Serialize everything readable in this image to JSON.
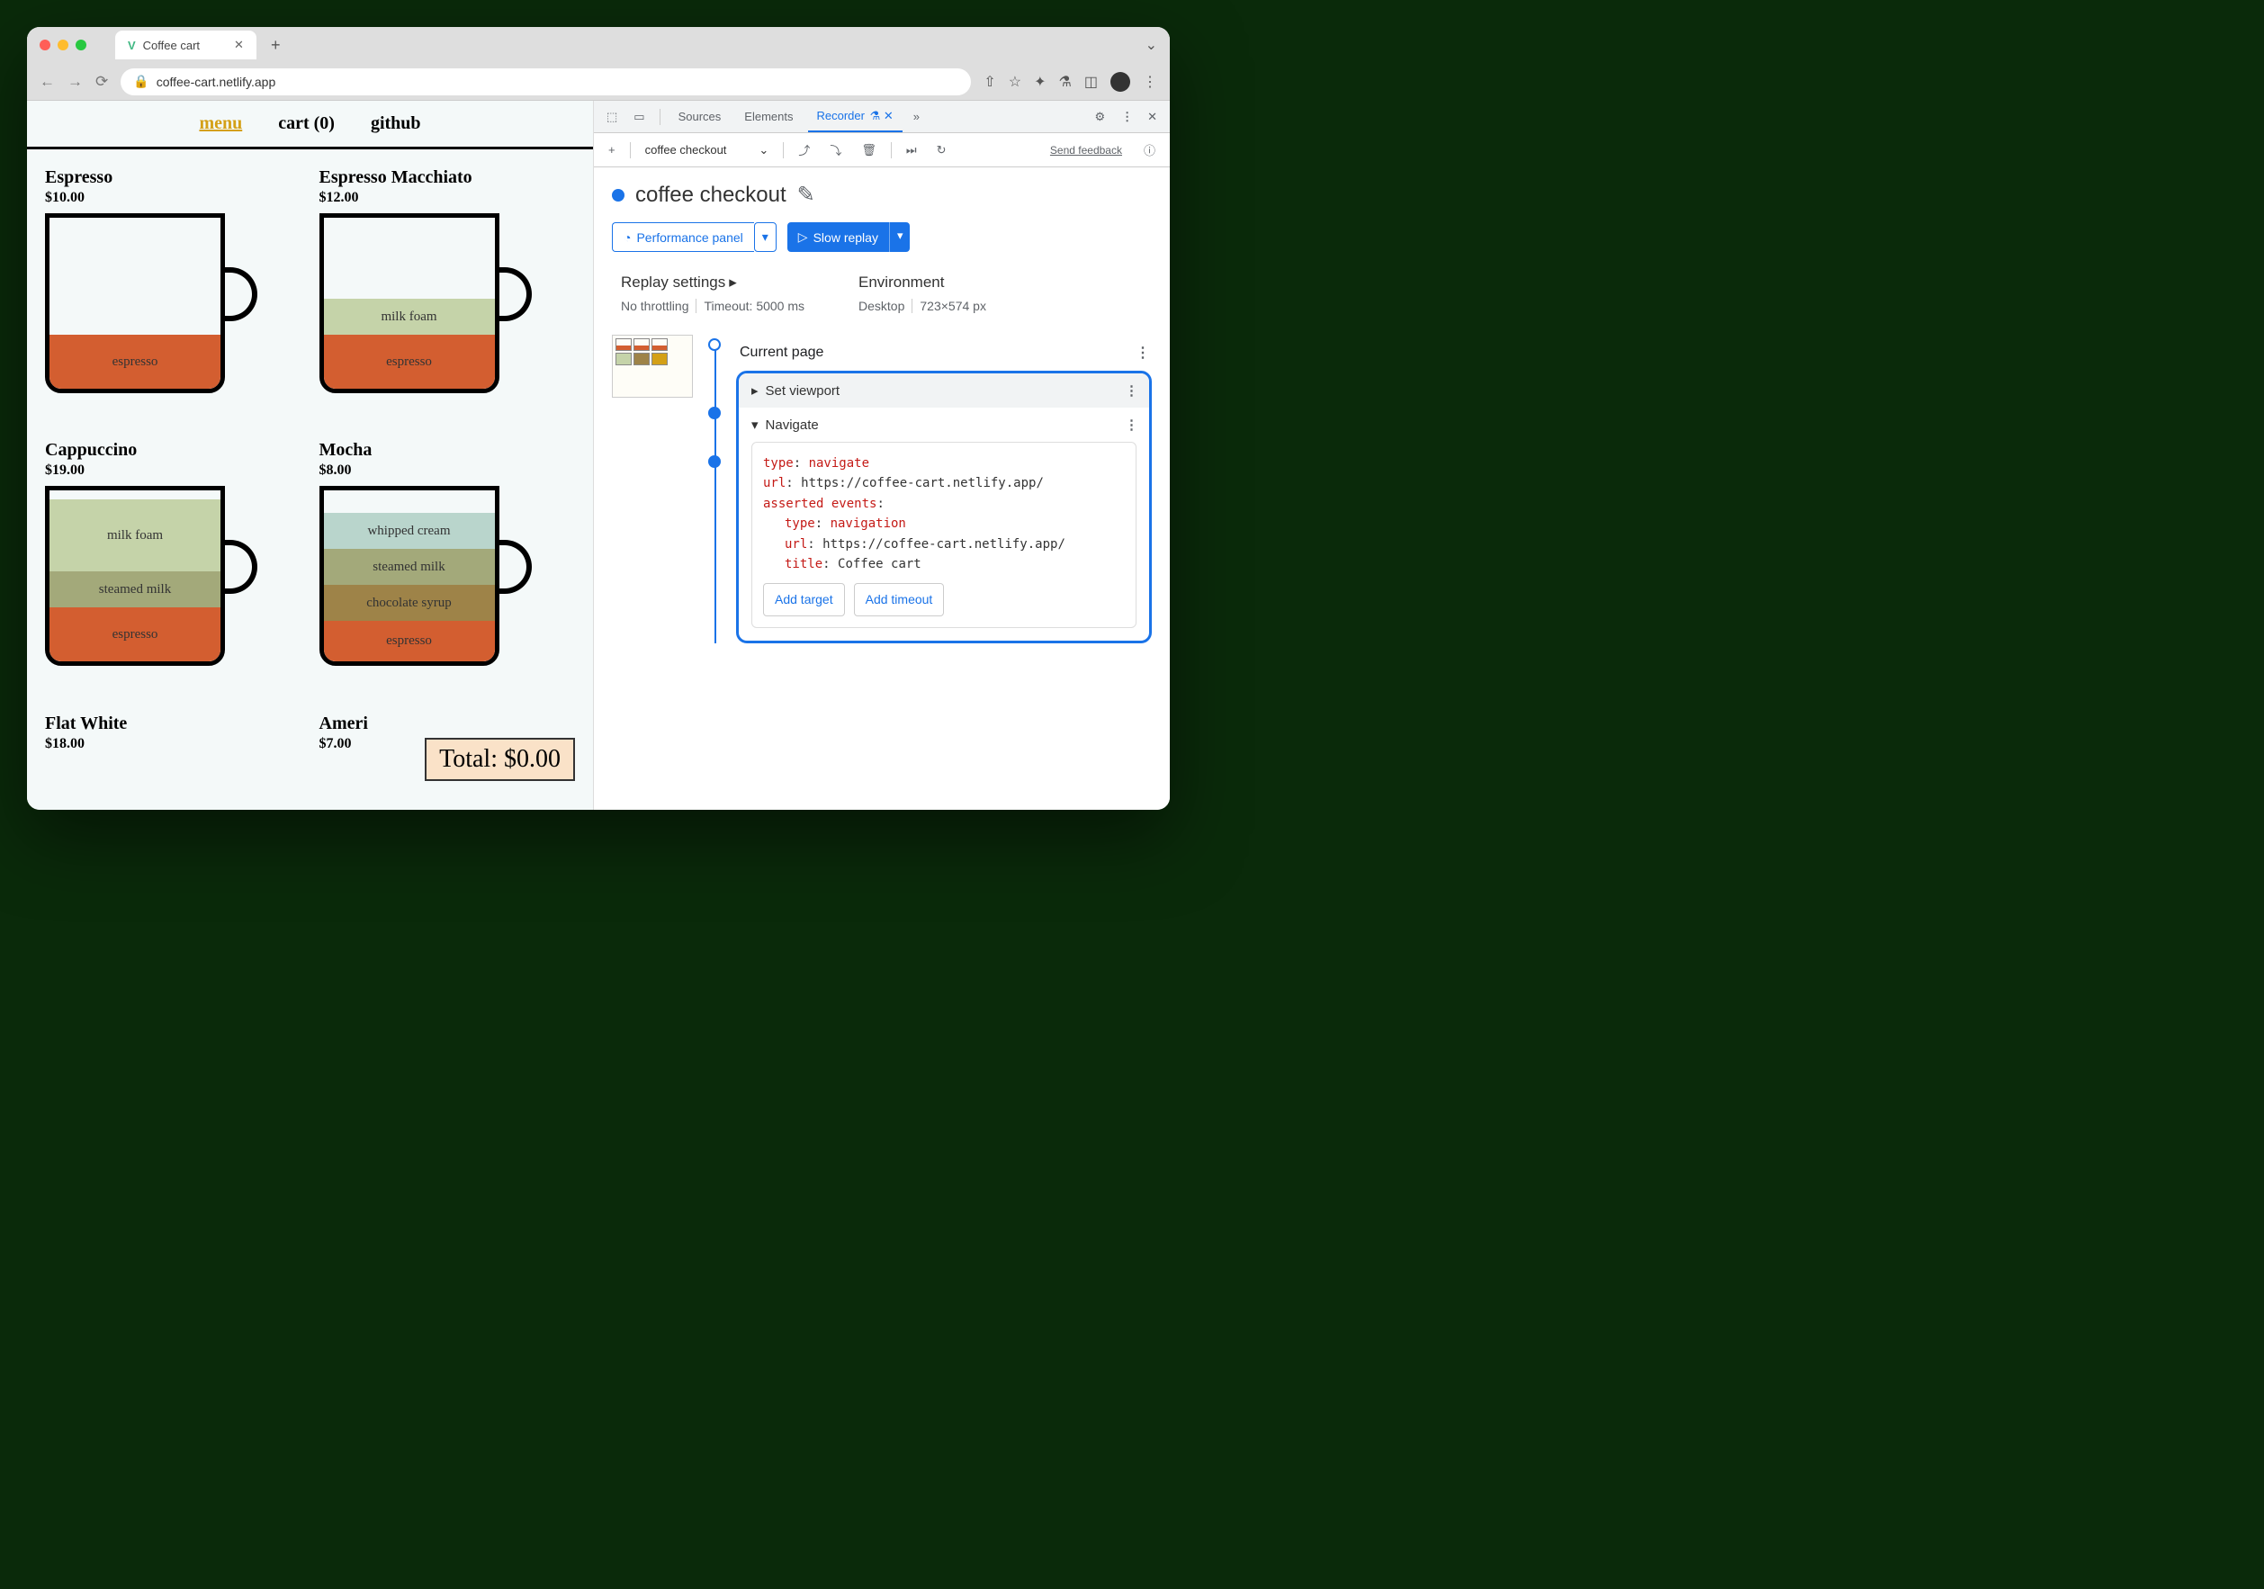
{
  "browser": {
    "tab_title": "Coffee cart",
    "url": "coffee-cart.netlify.app"
  },
  "page": {
    "nav": {
      "menu": "menu",
      "cart": "cart (0)",
      "github": "github"
    },
    "products": [
      {
        "name": "Espresso",
        "price": "$10.00"
      },
      {
        "name": "Espresso Macchiato",
        "price": "$12.00"
      },
      {
        "name": "Cappuccino",
        "price": "$19.00"
      },
      {
        "name": "Mocha",
        "price": "$8.00"
      },
      {
        "name": "Flat White",
        "price": "$18.00"
      },
      {
        "name": "Americano",
        "price": "$7.00"
      }
    ],
    "layers": {
      "espresso": "espresso",
      "milk_foam": "milk foam",
      "steamed_milk": "steamed milk",
      "whipped": "whipped cream",
      "choc": "chocolate syrup"
    },
    "total": "Total: $0.00"
  },
  "devtools": {
    "tabs": {
      "sources": "Sources",
      "elements": "Elements",
      "recorder": "Recorder"
    },
    "toolbar": {
      "recording_name": "coffee checkout",
      "feedback": "Send feedback"
    },
    "title": "coffee checkout",
    "buttons": {
      "perf": "Performance panel",
      "replay": "Slow replay"
    },
    "settings": {
      "replay_h": "Replay settings",
      "throttle": "No throttling",
      "timeout": "Timeout: 5000 ms",
      "env_h": "Environment",
      "env_device": "Desktop",
      "env_size": "723×574 px"
    },
    "steps": {
      "current": "Current page",
      "viewport": "Set viewport",
      "navigate": "Navigate",
      "detail": {
        "type_k": "type",
        "type_v": "navigate",
        "url_k": "url",
        "url_v": "https://coffee-cart.netlify.app/",
        "asserted_k": "asserted events",
        "nav_type_v": "navigation",
        "title_k": "title",
        "title_v": "Coffee cart",
        "add_target": "Add target",
        "add_timeout": "Add timeout"
      }
    }
  }
}
